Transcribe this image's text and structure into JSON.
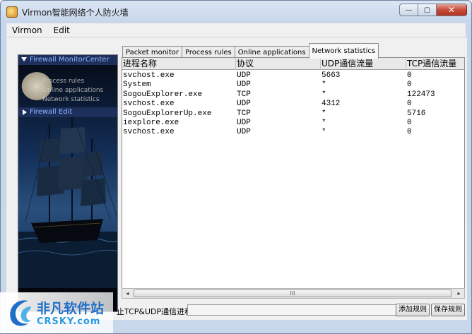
{
  "window": {
    "title": "Virmon智能网络个人防火墙"
  },
  "window_controls": {
    "minimize": "—",
    "maximize": "▢",
    "close": "✕"
  },
  "menu": [
    "Virmon",
    "Edit"
  ],
  "tree": {
    "head": "Firewall MonitorCenter",
    "sub_items": [
      "Process rules",
      "Online applications",
      "Network statistics"
    ],
    "edit": "Firewall Edit"
  },
  "tabs": [
    {
      "label": "Packet monitor",
      "active": false
    },
    {
      "label": "Process rules",
      "active": false
    },
    {
      "label": "Online applications",
      "active": false
    },
    {
      "label": "Network statistics",
      "active": true
    }
  ],
  "table": {
    "columns": [
      "进程名称",
      "协议",
      "UDP通信流量",
      "TCP通信流量"
    ],
    "rows": [
      [
        "svchost.exe",
        "UDP",
        "5663",
        "0"
      ],
      [
        "System",
        "UDP",
        "*",
        "0"
      ],
      [
        "SogouExplorer.exe",
        "TCP",
        "*",
        "122473"
      ],
      [
        "svchost.exe",
        "UDP",
        "4312",
        "0"
      ],
      [
        "SogouExplorerUp.exe",
        "TCP",
        "*",
        "5716"
      ],
      [
        "iexplore.exe",
        "UDP",
        "*",
        "0"
      ],
      [
        "svchost.exe",
        "UDP",
        "*",
        "0"
      ]
    ]
  },
  "scrollbar": {
    "left": "◂",
    "right": "▸",
    "grip": "III"
  },
  "bottom": {
    "label": "止TCP&UDP通信进程",
    "input_value": "",
    "add_button": "添加规则",
    "save_button": "保存规则"
  },
  "watermark": {
    "line1": "非凡软件站",
    "line2": "CRSKY.com"
  },
  "colors": {
    "tree_highlight": "#1d2f5a",
    "tree_text": "#8fb6ff",
    "close_button": "#c64a38",
    "watermark": "#1f6fc9"
  }
}
